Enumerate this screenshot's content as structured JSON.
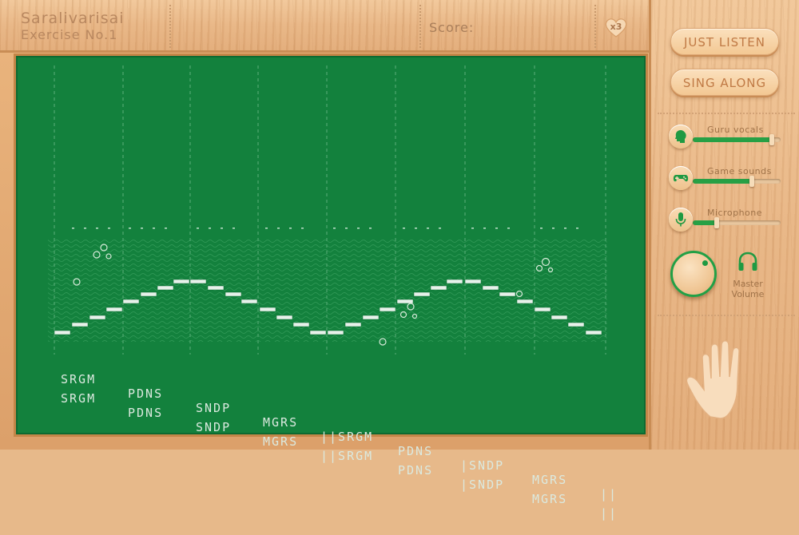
{
  "header": {
    "title": "Saralivarisai",
    "subtitle": "Exercise No.1",
    "score_label": "Score:",
    "lives": "x3"
  },
  "board": {
    "notes_row1": [
      "SRGM",
      "PDNS",
      "SNDP",
      "MGRS",
      "||SRGM",
      "PDNS",
      "|SNDP",
      "MGRS",
      "||"
    ],
    "notes_row2": [
      "SRGM",
      "PDNS",
      "SNDP",
      "MGRS",
      "||SRGM",
      "PDNS",
      "|SNDP",
      "MGRS",
      "||"
    ]
  },
  "sidebar": {
    "just_listen": "JUST LISTEN",
    "sing_along": "SING ALONG",
    "guru_vocals_label": "Guru vocals",
    "guru_vocals_level": 0.9,
    "game_sounds_label": "Game sounds",
    "game_sounds_level": 0.67,
    "microphone_label": "Microphone",
    "microphone_level": 0.27,
    "master_volume_label_1": "Master",
    "master_volume_label_2": "Volume"
  },
  "icons": {
    "lives": "heart-icon",
    "guru_vocals": "head-icon",
    "game_sounds": "gamepad-icon",
    "microphone": "microphone-icon",
    "master_volume": "headphones-icon",
    "hand": "hand-icon"
  },
  "colors": {
    "board": "#13813d",
    "accent_green": "#27a045",
    "button_text": "#c07a45"
  }
}
